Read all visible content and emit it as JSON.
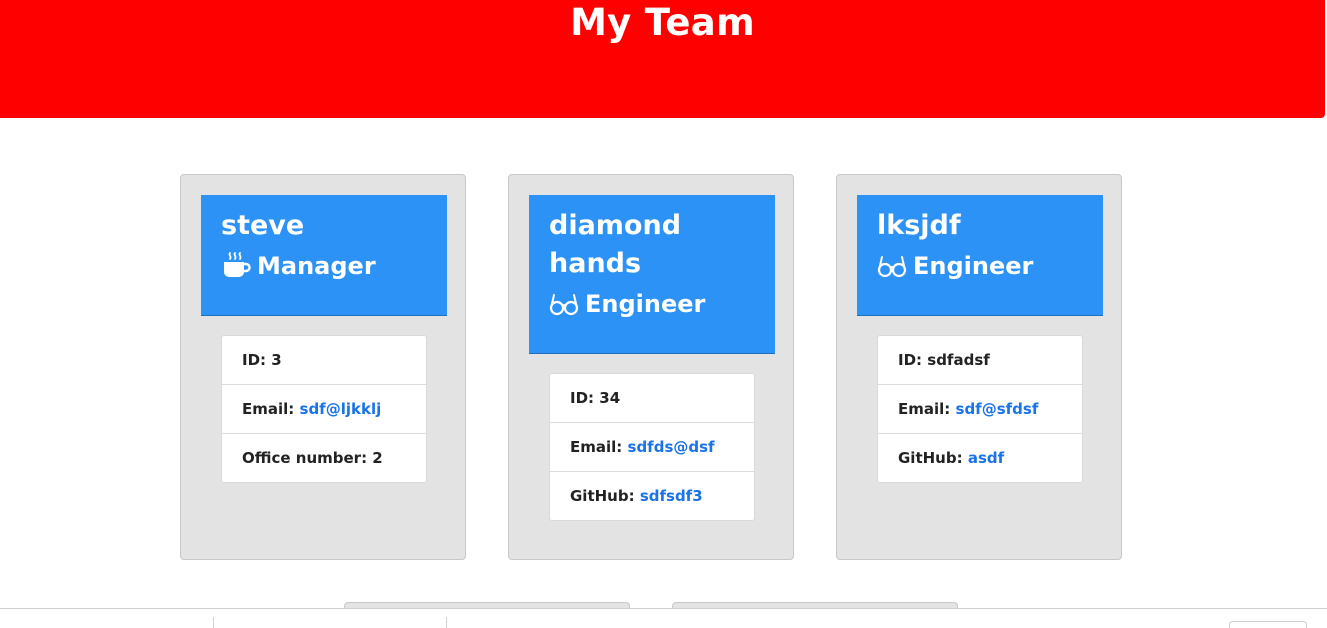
{
  "header": {
    "title": "My Team"
  },
  "team": [
    {
      "name": "steve",
      "role": "Manager",
      "role_icon": "mug-icon",
      "id_label": "ID:",
      "id_value": "3",
      "email_label": "Email:",
      "email": "sdf@ljkklj",
      "extra_label": "Office number:",
      "extra_value": "2"
    },
    {
      "name": "diamond hands",
      "role": "Engineer",
      "role_icon": "glasses-icon",
      "id_label": "ID:",
      "id_value": "34",
      "email_label": "Email:",
      "email": "sdfds@dsf",
      "extra_label": "GitHub:",
      "extra_value": "sdfsdf3"
    },
    {
      "name": "lksjdf",
      "role": "Engineer",
      "role_icon": "glasses-icon",
      "id_label": "ID:",
      "id_value": "sdfadsf",
      "email_label": "Email:",
      "email": "sdf@sfdsf",
      "extra_label": "GitHub:",
      "extra_value": "asdf"
    }
  ],
  "colors": {
    "header_bg": "#ff0000",
    "card_head_bg": "#2d92f5",
    "card_bg": "#e3e3e3",
    "link": "#1a73e8"
  }
}
